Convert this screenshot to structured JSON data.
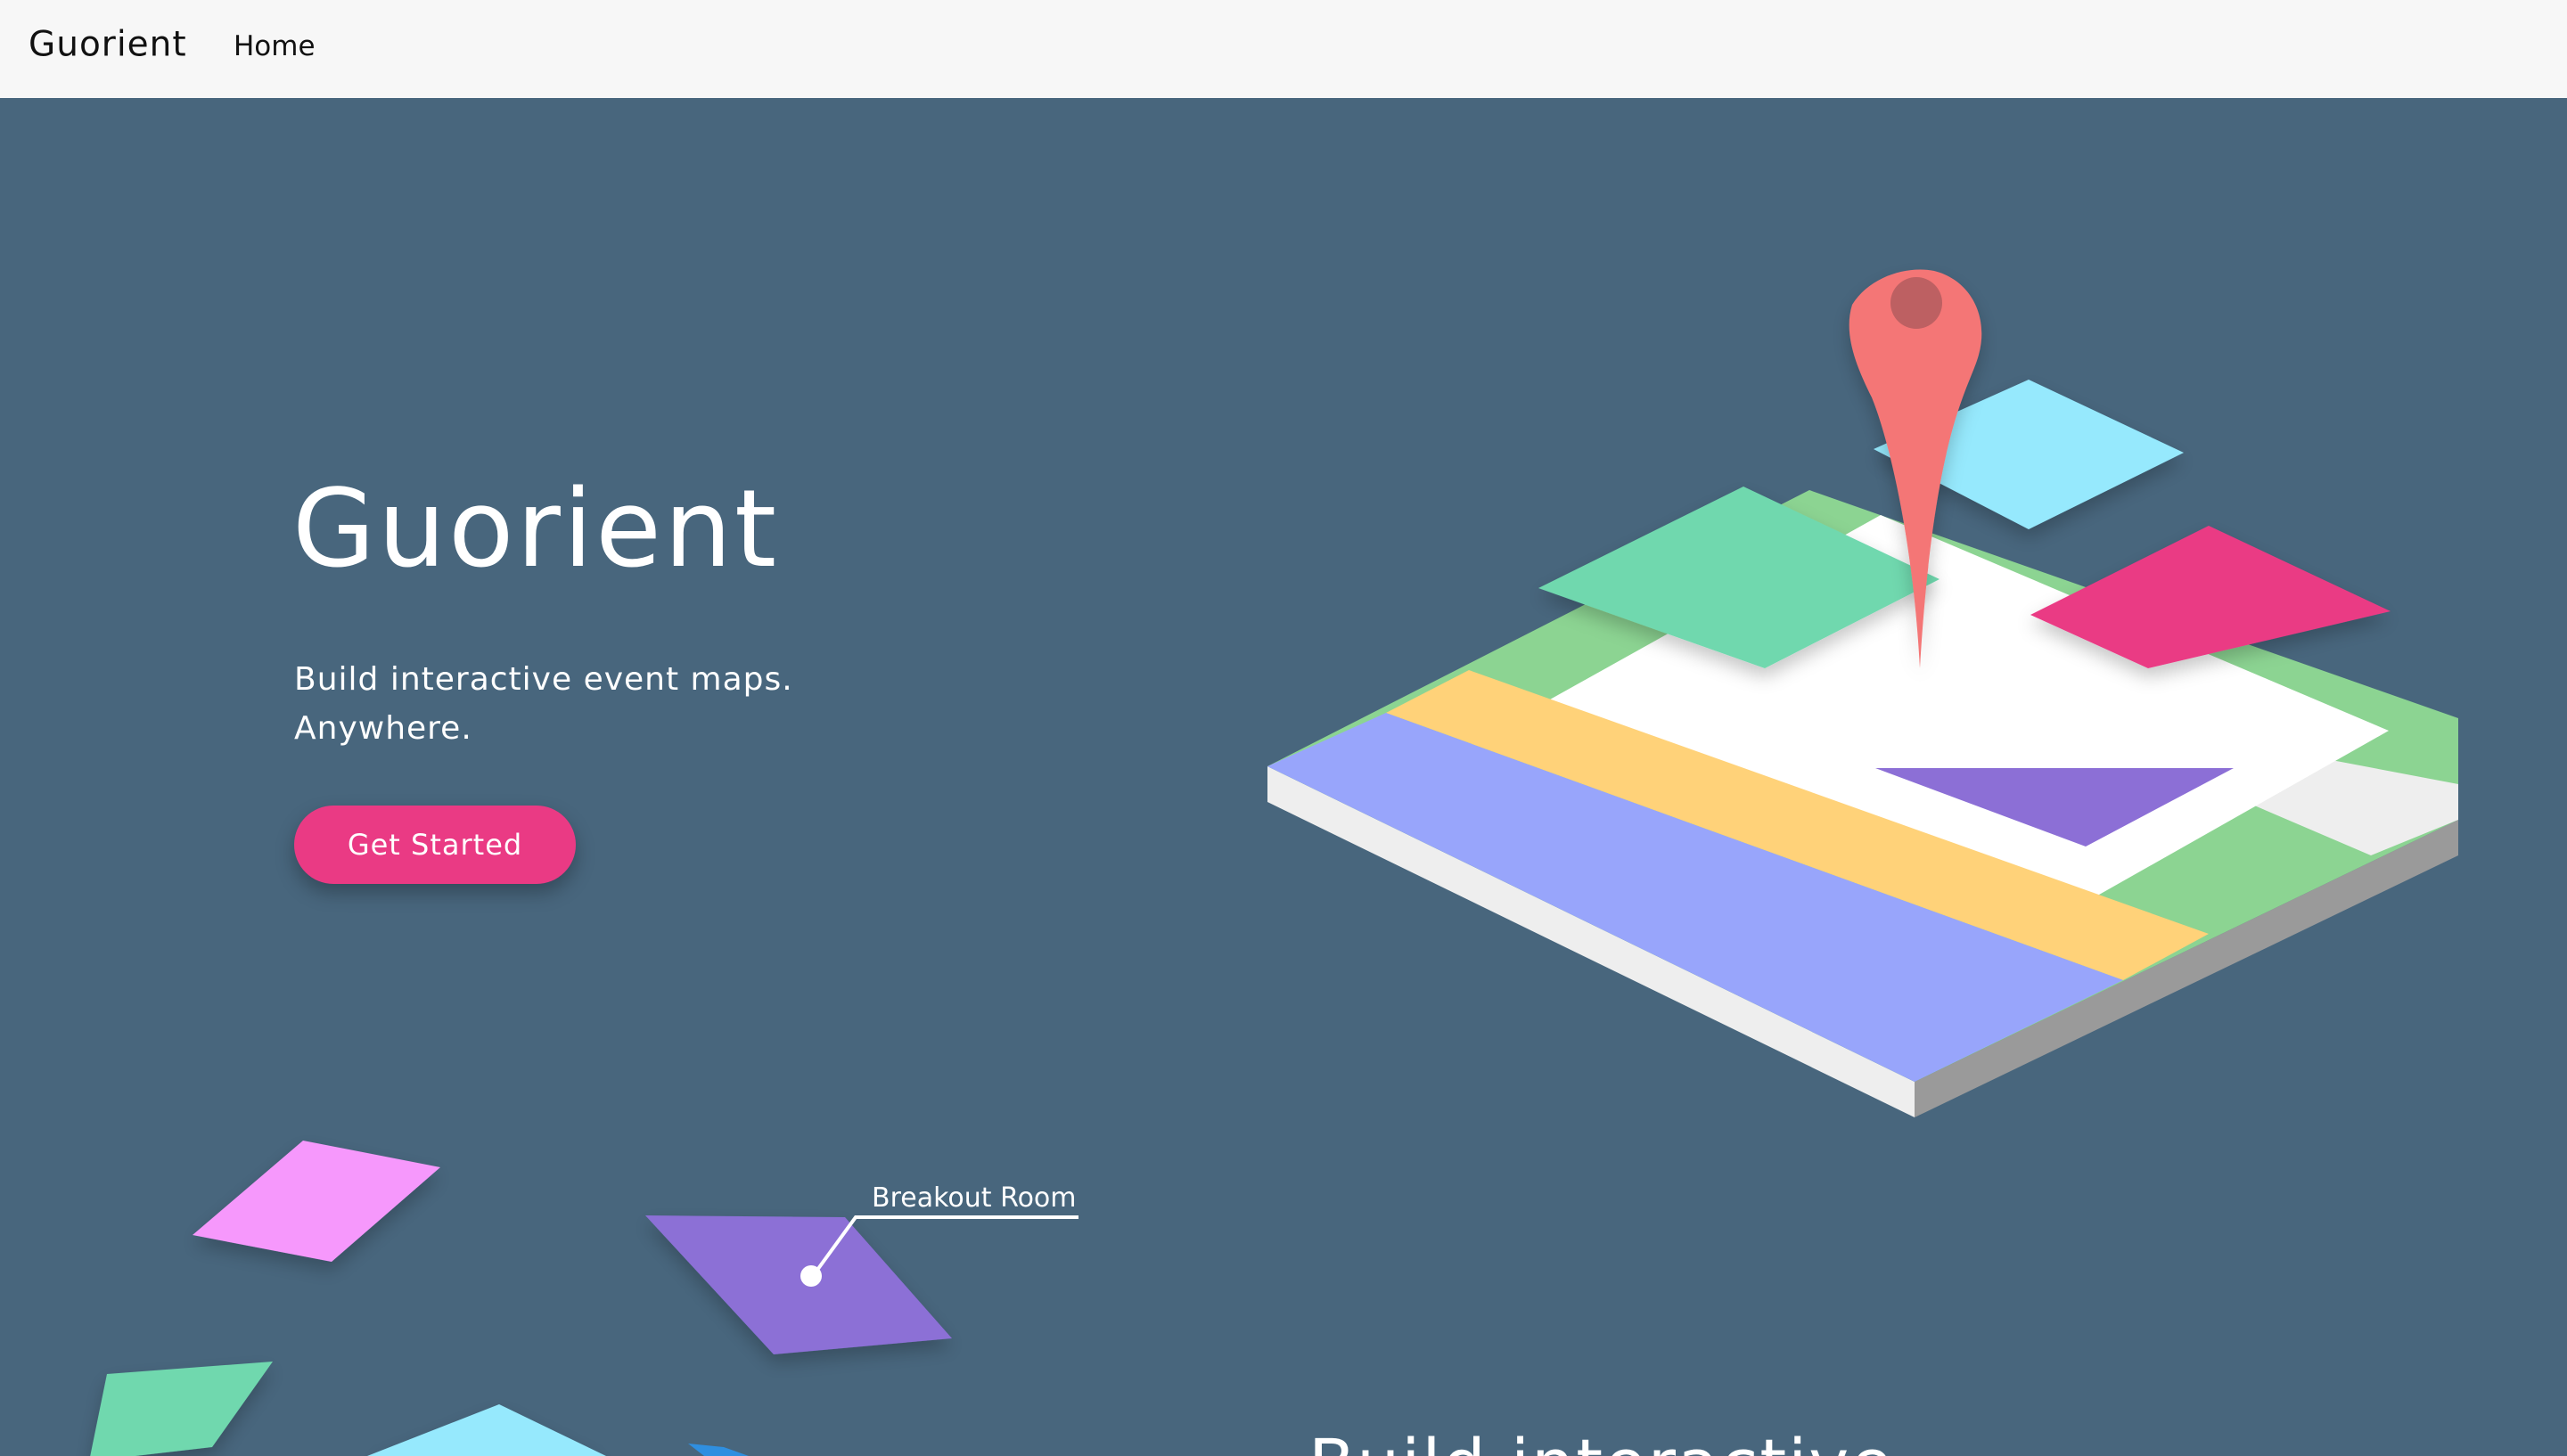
{
  "navbar": {
    "brand": "Guorient",
    "links": [
      {
        "label": "Home"
      }
    ]
  },
  "hero": {
    "title": "Guorient",
    "tagline_lines": [
      "Build interactive event maps.",
      "Anywhere."
    ],
    "cta_label": "Get Started"
  },
  "illustration": {
    "callout_label": "Breakout Room"
  },
  "next_section": {
    "heading": "Build interactive"
  },
  "colors": {
    "navbar_bg": "#f7f7f7",
    "hero_bg": "#48667d",
    "accent_pink": "#ea3a84",
    "pin_red": "#f47676",
    "mint": "#6fd8ae",
    "sky": "#96e9fd",
    "periwinkle": "#98a5fb",
    "sand": "#ffd279",
    "grass": "#8cd492",
    "violet": "#8c6fd6",
    "orchid": "#f698fc"
  }
}
